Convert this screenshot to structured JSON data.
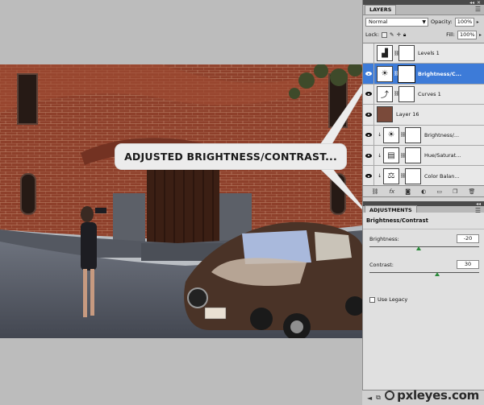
{
  "callout": {
    "text": "ADJUSTED BRIGHTNESS/CONTRAST..."
  },
  "layers_panel": {
    "tab": "LAYERS",
    "blend_mode": "Normal",
    "opacity_label": "Opacity:",
    "opacity_value": "100%",
    "lock_label": "Lock:",
    "fill_label": "Fill:",
    "fill_value": "100%",
    "layers": [
      {
        "name": "Levels 1",
        "visible": false,
        "selected": false,
        "thumb_icon": "levels-icon"
      },
      {
        "name": "Brightness/C...",
        "visible": true,
        "selected": true,
        "thumb_icon": "brightness-icon"
      },
      {
        "name": "Curves 1",
        "visible": true,
        "selected": false,
        "thumb_icon": "curves-icon"
      },
      {
        "name": "Layer 16",
        "visible": true,
        "selected": false,
        "thumb_icon": "image-thumbnail"
      },
      {
        "name": "Brightness/...",
        "visible": true,
        "selected": false,
        "thumb_icon": "brightness-icon"
      },
      {
        "name": "Hue/Saturat...",
        "visible": true,
        "selected": false,
        "thumb_icon": "hue-saturation-icon"
      },
      {
        "name": "Color Balan...",
        "visible": true,
        "selected": false,
        "thumb_icon": "color-balance-icon"
      }
    ]
  },
  "adjustments_panel": {
    "tab": "ADJUSTMENTS",
    "title": "Brightness/Contrast",
    "brightness_label": "Brightness:",
    "brightness_value": "-20",
    "brightness_fraction": 0.45,
    "contrast_label": "Contrast:",
    "contrast_value": "30",
    "contrast_fraction": 0.62,
    "use_legacy_label": "Use Legacy"
  },
  "watermark": "pxleyes.com",
  "colors": {
    "selection": "#3d7bd8",
    "brick": "#8c3f2c",
    "panel": "#d4d4d4"
  }
}
